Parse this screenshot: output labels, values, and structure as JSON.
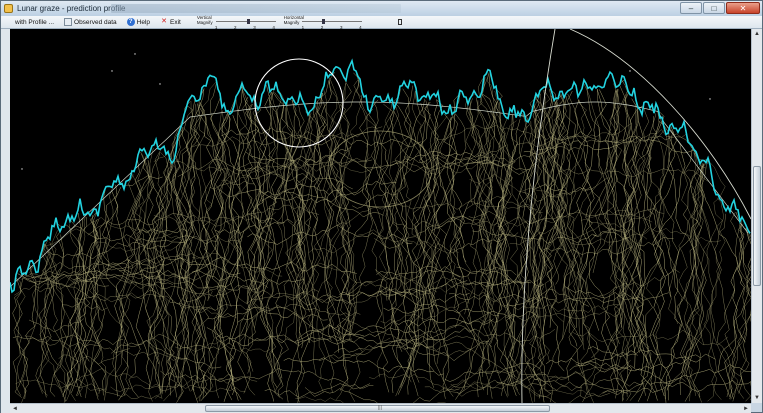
{
  "window": {
    "title": "Lunar graze - prediction profile",
    "buttons": {
      "minimize": "–",
      "maximize": "□",
      "close": "✕"
    }
  },
  "toolbar": {
    "with_profile": "with Profile ...",
    "observed_data": "Observed data",
    "help": "Help",
    "exit": "Exit",
    "vertical_label": "Vertical",
    "vertical_magnify": "Magnify",
    "vertical_ticks": [
      "1",
      "2",
      "3",
      "4"
    ],
    "vertical_level": 0.55,
    "horizontal_label": "Horizontal",
    "horizontal_magnify": "Magnify",
    "horizontal_ticks": [
      "1",
      "2",
      "3",
      "4"
    ],
    "horizontal_level": 0.35
  },
  "scroll": {
    "up": "▲",
    "down": "▼",
    "left": "◄",
    "right": "►",
    "grip": "|||",
    "v_position": 0.55,
    "h_position": 0.5
  },
  "colors": {
    "profile_line": "#22d3e0",
    "terrain": "#b7b27e",
    "background": "#000000",
    "circle": "#ffffff"
  }
}
